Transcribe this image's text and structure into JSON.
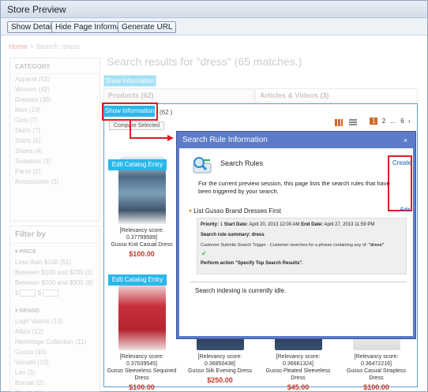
{
  "window": {
    "title": "Store Preview"
  },
  "toolbar": {
    "show_details": "Show Details",
    "hide_page_info": "Hide Page Information",
    "generate_url": "Generate URL"
  },
  "breadcrumb": {
    "home": "Home",
    "separator": ">",
    "current": "Search: dress"
  },
  "sidebar": {
    "category_heading": "CATEGORY",
    "categories": [
      "Apparel (62)",
      "Women (42)",
      "Dresses (39)",
      "Men (13)",
      "Girls (7)",
      "Skirts (7)",
      "Shirts (5)",
      "Shoes (4)",
      "Sweaters (3)",
      "Pants (2)",
      "Accessories (2)"
    ],
    "filter_heading": "Filter by",
    "price_heading": "PRICE",
    "prices": [
      "Less than $100 (51)",
      "Between $100 and $200 (2)",
      "Between $200 and $300 (8)"
    ],
    "price_from_symbol": "$",
    "price_to_symbol": "$",
    "brand_heading": "BRAND",
    "brands": [
      "Lugri Valenti (13)",
      "Albini (12)",
      "Hermitage Collection (11)",
      "Gusso (10)",
      "Versatil (10)",
      "Leo (3)",
      "Borsati (2)",
      "Glacio (1)"
    ]
  },
  "results": {
    "title": "Search results for \"dress\" (65 matches.)",
    "tab_products": "Products (62)",
    "tab_articles": "Articles & Videos (3)",
    "count_suffix": "(62 )",
    "compare_label": "Compare Selected",
    "pages": [
      "1",
      "2",
      "...",
      "6"
    ],
    "next_icon": "›"
  },
  "show_info_button": "Show Information",
  "edit_catalog_button": "Edit Catalog Entry",
  "products": [
    {
      "score": "[Relevancy score: 0.37799589]",
      "name": "Gusso Knit Casual Dress",
      "price": "$100.00"
    },
    {
      "score": "[Relevancy score: 0.37039545]",
      "name": "Gusso Sleeveless Sequined Dress",
      "price": "$100.00"
    },
    {
      "score": "[Relevancy score: 0.36850438]",
      "name": "Gusso Silk Evening Dress",
      "price": "$250.00"
    },
    {
      "score": "[Relevancy score: 0.36661324]",
      "name": "Gusso Pleated Sleeveless Dress",
      "price": "$45.00"
    },
    {
      "score": "[Relevancy score: 0.36472216]",
      "name": "Gusso Casual Strapless Dress",
      "price": "$100.00"
    }
  ],
  "dialog": {
    "title": "Search Rule Information",
    "close_glyph": "×",
    "section_title": "Search Rules",
    "create_link": "Create",
    "description": "For the current preview session, this page lists the search rules that have been triggered by your search.",
    "rule_name": "List Gusso Brand Dresses First",
    "edit_link": "Edit",
    "priority_label": "Priority:",
    "priority_value": "1",
    "start_label": "Start Date:",
    "start_value": "April 20, 2013 12:00 AM",
    "end_label": "End Date:",
    "end_value": "April 27, 2013 11:59 PM",
    "summary_label": "Search rule summary: dress",
    "trigger_text": "Customer Submits Search Trigger - Customer searches for a phrase containing any of:",
    "trigger_term": "\"dress\"",
    "action_text": "Perform action \"Specify Top Search Results\".",
    "status_text": "Search indexing is currently idle."
  },
  "colors": {
    "accent_red": "#e01b24",
    "dialog_blue": "#5c7bc8",
    "button_cyan": "#29b8ea",
    "price_red": "#c0392b",
    "panel_border": "#5b9bd5"
  }
}
